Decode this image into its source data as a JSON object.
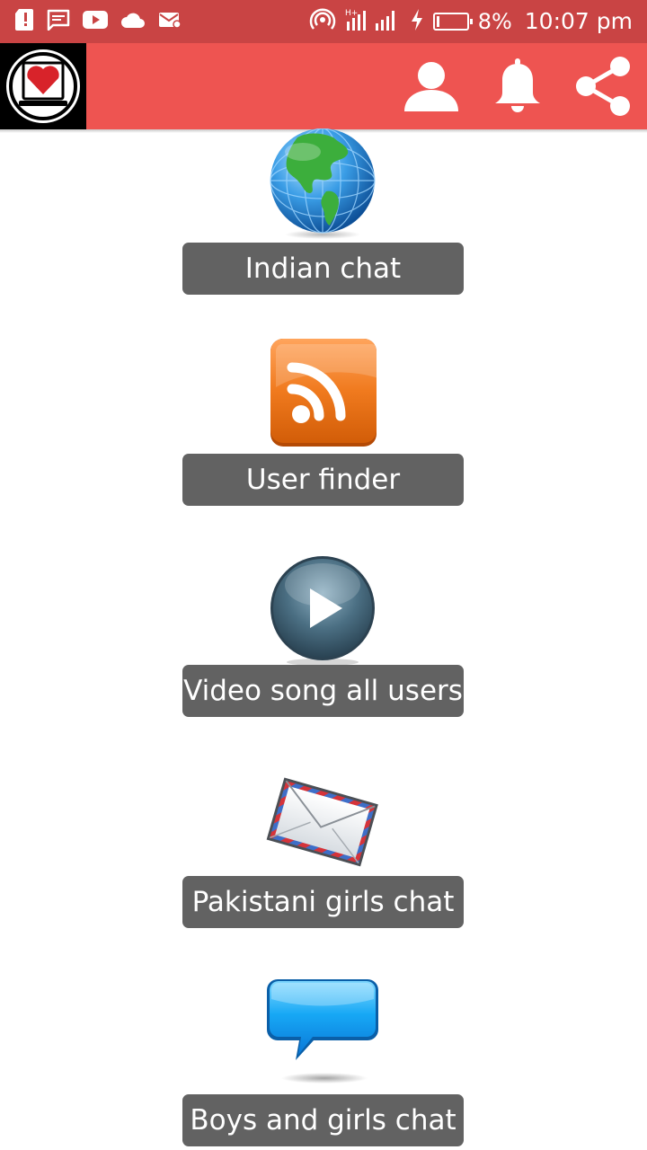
{
  "status_bar": {
    "battery_percent": "8%",
    "time": "10:07 pm",
    "battery_level": 0.08,
    "left_icons": [
      "sd-card-icon",
      "message-icon",
      "youtube-icon",
      "cloud-icon",
      "mail-icon"
    ],
    "right_icons": [
      "hotspot-icon",
      "signal-icon",
      "charging-icon",
      "battery-icon"
    ]
  },
  "app_bar": {
    "logo_icon": "heart-laptop-logo-icon",
    "actions": [
      "user-icon",
      "bell-icon",
      "share-icon"
    ],
    "colors": {
      "bar": "#ee5451",
      "status": "#c94444"
    }
  },
  "menu": {
    "items": [
      {
        "label": "Indian chat",
        "icon": "globe-icon"
      },
      {
        "label": "User finder",
        "icon": "rss-icon"
      },
      {
        "label": "Video song all users",
        "icon": "play-icon"
      },
      {
        "label": "Pakistani girls chat",
        "icon": "envelope-icon"
      },
      {
        "label": "Boys and girls chat",
        "icon": "chat-bubble-icon"
      }
    ],
    "button_color": "#626262"
  }
}
